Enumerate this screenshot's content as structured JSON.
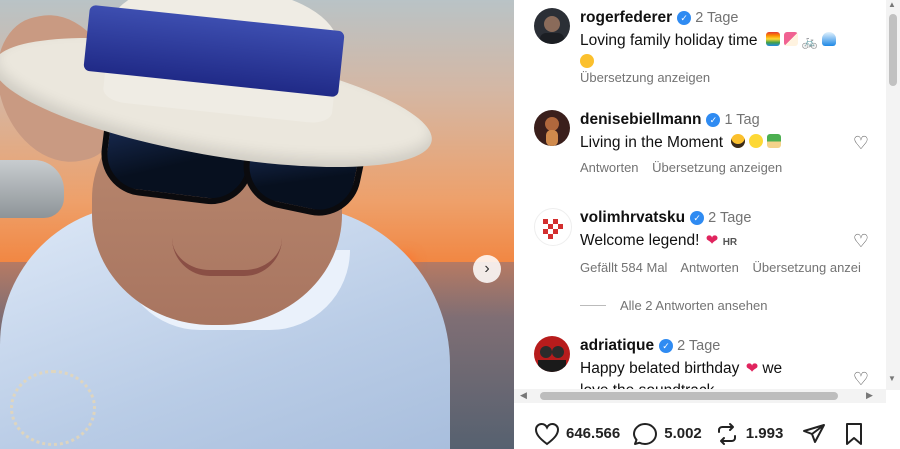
{
  "photo": {
    "next_button_icon": "chevron-right-icon",
    "next_button_symbol": "›"
  },
  "comments": [
    {
      "username": "rogerfederer",
      "verified": true,
      "time": "2 Tage",
      "text": "Loving family holiday time",
      "emojis": [
        "rainbow-flag-emoji",
        "beach-umbrella-emoji",
        "bicycle-emoji",
        "wave-emoji",
        "sun-emoji"
      ],
      "actions": [
        "Übersetzung anzeigen"
      ]
    },
    {
      "username": "denisebiellmann",
      "verified": true,
      "time": "1 Tag",
      "text": "Living in the Moment",
      "emojis": [
        "sunglasses-emoji",
        "sun-emoji",
        "palm-island-emoji"
      ],
      "actions": [
        "Antworten",
        "Übersetzung anzeigen"
      ]
    },
    {
      "username": "volimhrvatsku",
      "verified": true,
      "time": "2 Tage",
      "text": "Welcome legend!",
      "emojis": [
        "heart-emoji",
        "croatia-flag-emoji"
      ],
      "flag_text": "HR",
      "actions": [
        "Gefällt 584 Mal",
        "Antworten",
        "Übersetzung anzei"
      ]
    },
    {
      "username": "adriatique",
      "verified": true,
      "time": "2 Tage",
      "text": "Happy belated birthday",
      "text_suffix": "we",
      "text_line2": "love the soundtrack",
      "emojis": [
        "heart-emoji"
      ],
      "actions": []
    }
  ],
  "view_replies": "Alle 2 Antworten ansehen",
  "stats": {
    "likes": "646.566",
    "comments": "5.002",
    "reposts": "1.993"
  },
  "colors": {
    "verified": "#2f8bf2",
    "secondary_text": "#737373",
    "heart_emoji": "#e0245e"
  }
}
